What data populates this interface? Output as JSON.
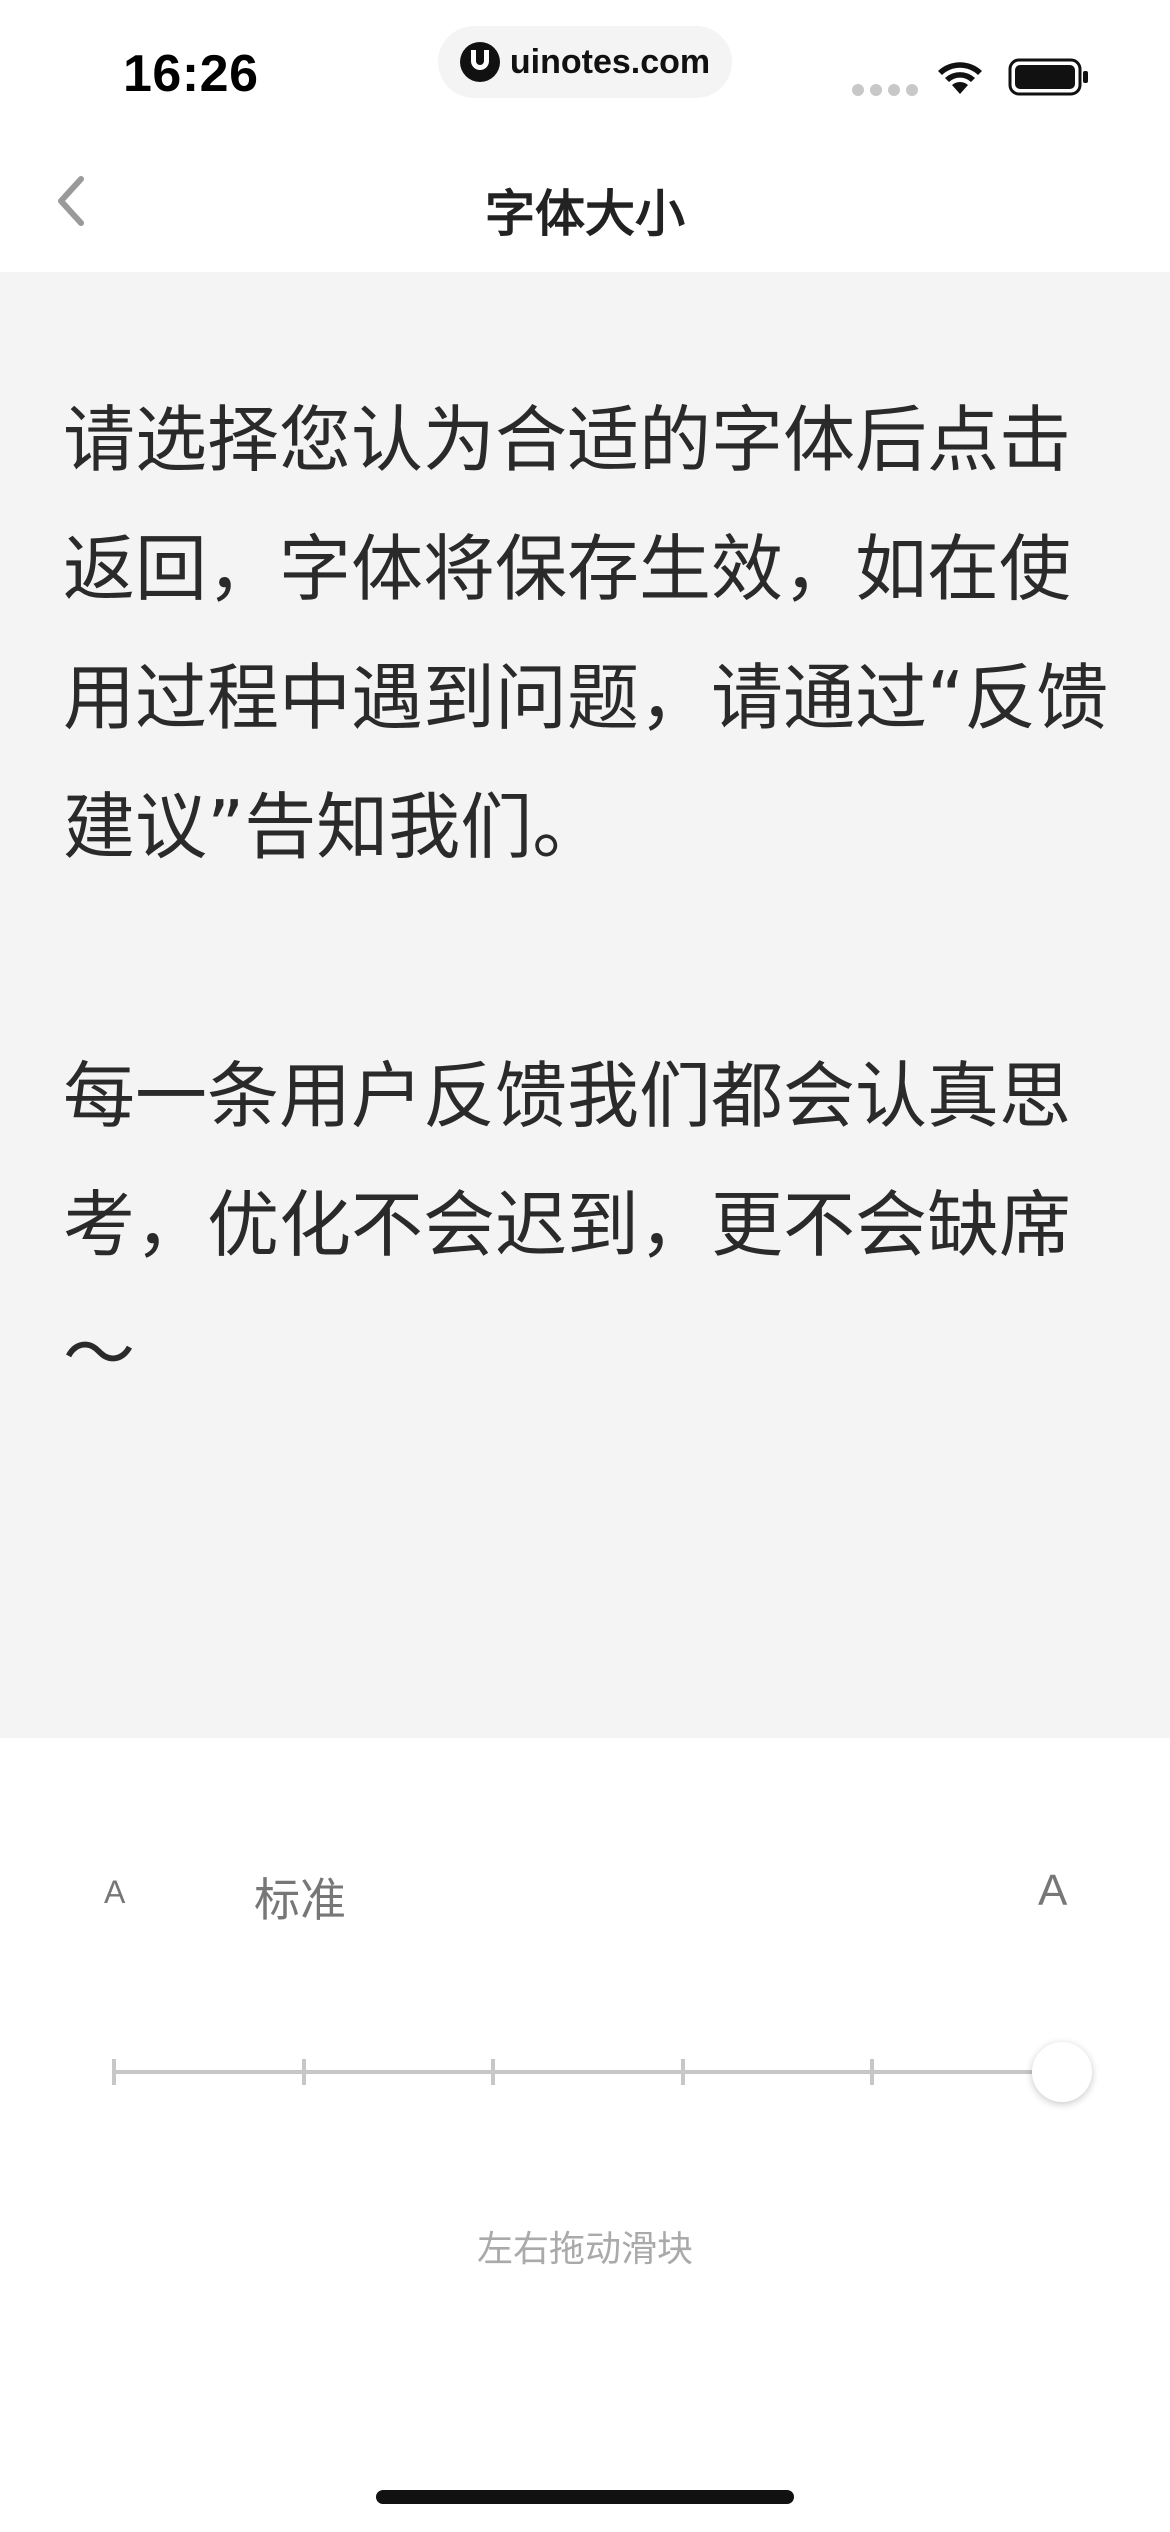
{
  "status_bar": {
    "time": "16:26",
    "site": "uinotes.com"
  },
  "nav": {
    "title": "字体大小"
  },
  "preview": {
    "paragraph_1": "请选择您认为合适的字体后点击返回，字体将保存生效，如在使用过程中遇到问题，请通过“反馈建议”告知我们。",
    "paragraph_2": "每一条用户反馈我们都会认真思考，优化不会迟到，更不会缺席～"
  },
  "controls": {
    "small_a": "A",
    "current_size_label": "标准",
    "large_a": "A",
    "hint": "左右拖动滑块",
    "slider": {
      "steps": 6,
      "selected_index": 5
    }
  },
  "colors": {
    "preview_background": "#f4f4f4",
    "slider_track": "#c7c7c7",
    "hint_text": "#aaaaaa"
  }
}
